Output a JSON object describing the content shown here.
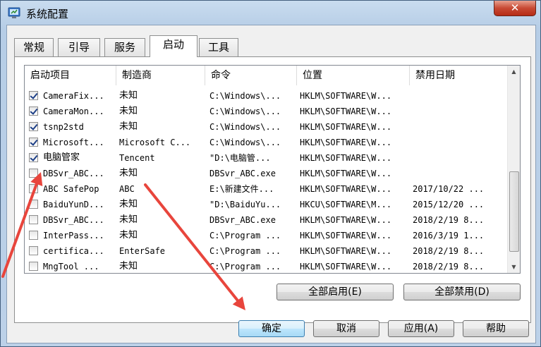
{
  "window": {
    "title": "系统配置",
    "close_label": "✕"
  },
  "tabs": [
    "常规",
    "引导",
    "服务",
    "启动",
    "工具"
  ],
  "active_tab": "启动",
  "columns": [
    "启动项目",
    "制造商",
    "命令",
    "位置",
    "禁用日期"
  ],
  "rows": [
    {
      "checked": true,
      "name": "CameraFix...",
      "maker": "未知",
      "cmd": "C:\\Windows\\...",
      "loc": "HKLM\\SOFTWARE\\W...",
      "date": ""
    },
    {
      "checked": true,
      "name": "CameraMon...",
      "maker": "未知",
      "cmd": "C:\\Windows\\...",
      "loc": "HKLM\\SOFTWARE\\W...",
      "date": ""
    },
    {
      "checked": true,
      "name": "tsnp2std",
      "maker": "未知",
      "cmd": "C:\\Windows\\...",
      "loc": "HKLM\\SOFTWARE\\W...",
      "date": ""
    },
    {
      "checked": true,
      "name": "Microsoft...",
      "maker": "Microsoft C...",
      "cmd": "C:\\Windows\\...",
      "loc": "HKLM\\SOFTWARE\\W...",
      "date": ""
    },
    {
      "checked": true,
      "name": "电脑管家",
      "maker": "Tencent",
      "cmd": "\"D:\\电脑管...",
      "loc": "HKLM\\SOFTWARE\\W...",
      "date": ""
    },
    {
      "checked": false,
      "name": "DBSvr_ABC...",
      "maker": "未知",
      "cmd": "DBSvr_ABC.exe",
      "loc": "HKLM\\SOFTWARE\\W...",
      "date": ""
    },
    {
      "checked": false,
      "name": "ABC SafePop",
      "maker": "ABC",
      "cmd": "E:\\新建文件...",
      "loc": "HKLM\\SOFTWARE\\W...",
      "date": "2017/10/22 ..."
    },
    {
      "checked": false,
      "name": "BaiduYunD...",
      "maker": "未知",
      "cmd": "\"D:\\BaiduYu...",
      "loc": "HKCU\\SOFTWARE\\M...",
      "date": "2015/12/20 ..."
    },
    {
      "checked": false,
      "name": "DBSvr_ABC...",
      "maker": "未知",
      "cmd": "DBSvr_ABC.exe",
      "loc": "HKLM\\SOFTWARE\\W...",
      "date": "2018/2/19 8..."
    },
    {
      "checked": false,
      "name": "InterPass...",
      "maker": "未知",
      "cmd": "C:\\Program ...",
      "loc": "HKLM\\SOFTWARE\\W...",
      "date": "2016/3/19 1..."
    },
    {
      "checked": false,
      "name": "certifica...",
      "maker": "EnterSafe",
      "cmd": "C:\\Program ...",
      "loc": "HKLM\\SOFTWARE\\W...",
      "date": "2018/2/19 8..."
    },
    {
      "checked": false,
      "name": "MngTool ...",
      "maker": "未知",
      "cmd": "C:\\Program ...",
      "loc": "HKLM\\SOFTWARE\\W...",
      "date": "2018/2/19 8..."
    }
  ],
  "buttons": {
    "enable_all": "全部启用(E)",
    "disable_all": "全部禁用(D)",
    "ok": "确定",
    "cancel": "取消",
    "apply": "应用(A)",
    "help": "帮助"
  },
  "colors": {
    "arrow": "#e8453c",
    "selection_border": "#3c7fb1"
  }
}
